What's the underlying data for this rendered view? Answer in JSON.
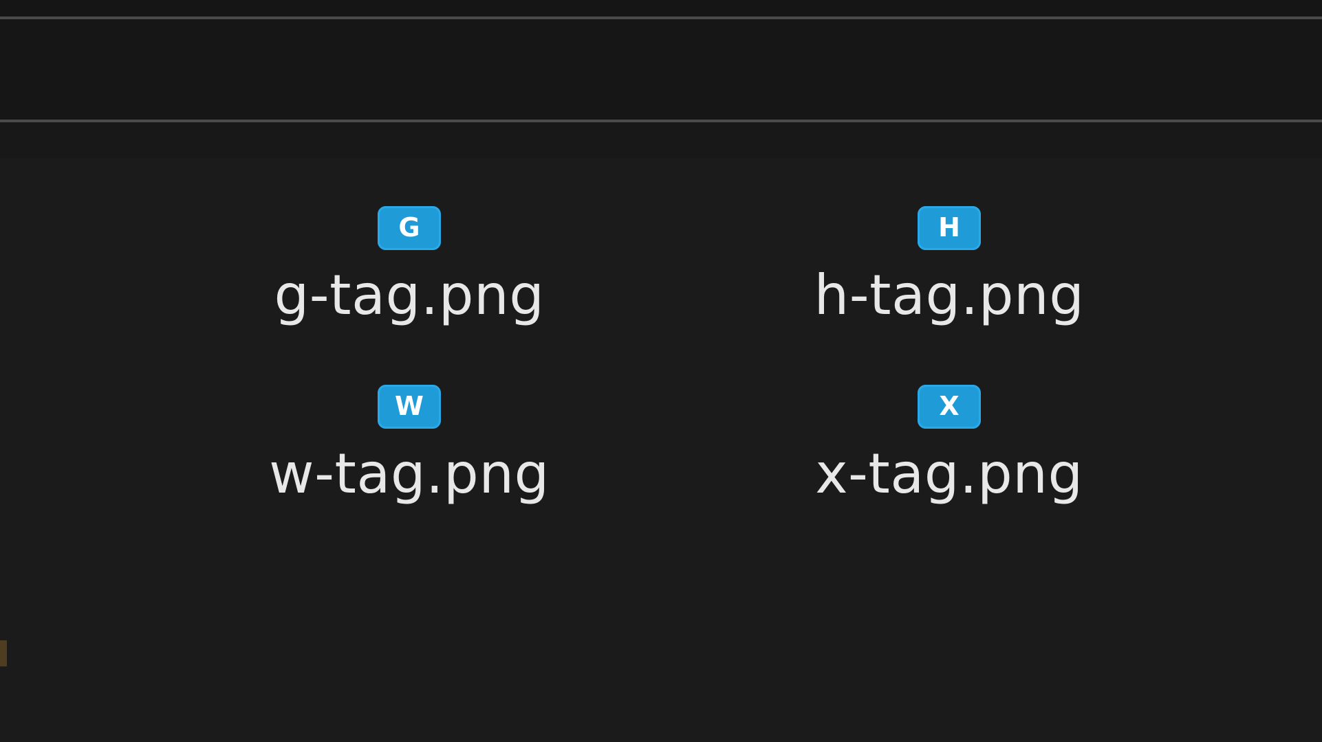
{
  "window": {
    "background": "#1b1b1b"
  },
  "files": [
    {
      "name": "g-tag.png",
      "icon_letter": "G",
      "icon": "file-image-icon",
      "icon_color": "#1f9bd8"
    },
    {
      "name": "h-tag.png",
      "icon_letter": "H",
      "icon": "file-image-icon",
      "icon_color": "#1f9bd8"
    },
    {
      "name": "w-tag.png",
      "icon_letter": "W",
      "icon": "file-image-icon",
      "icon_color": "#1f9bd8"
    },
    {
      "name": "x-tag.png",
      "icon_letter": "X",
      "icon": "file-image-icon",
      "icon_color": "#1f9bd8"
    }
  ]
}
